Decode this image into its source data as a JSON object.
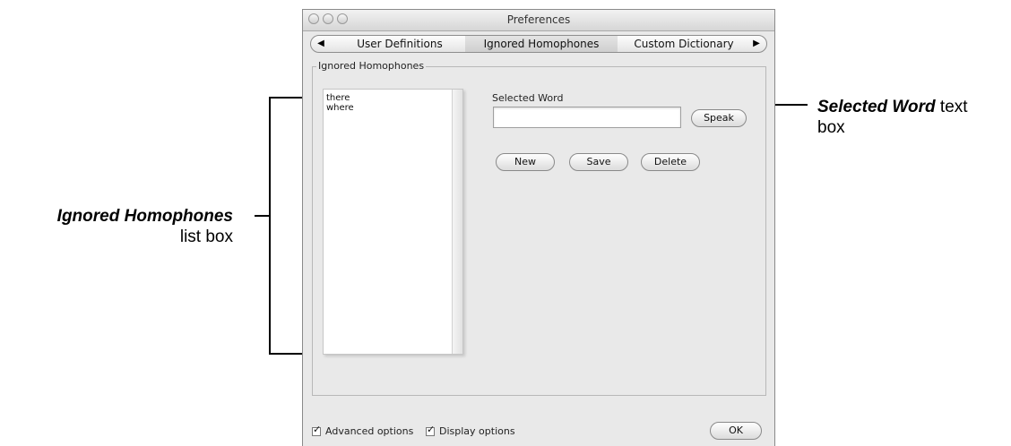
{
  "window": {
    "title": "Preferences",
    "tabs": [
      "User Definitions",
      "Ignored Homophones",
      "Custom Dictionary"
    ],
    "active_tab": "Ignored Homophones"
  },
  "group": {
    "label": "Ignored Homophones"
  },
  "list": {
    "items": [
      "there",
      "where"
    ]
  },
  "selected_word": {
    "label": "Selected Word",
    "value": ""
  },
  "buttons": {
    "speak": "Speak",
    "new": "New",
    "save": "Save",
    "delete": "Delete",
    "ok": "OK"
  },
  "footer": {
    "advanced": "Advanced options",
    "display": "Display options"
  },
  "callouts": {
    "left_bold": "Ignored Homophones",
    "left_rest": "list box",
    "right_bold": "Selected Word",
    "right_rest": " text",
    "right_rest2": "box"
  }
}
